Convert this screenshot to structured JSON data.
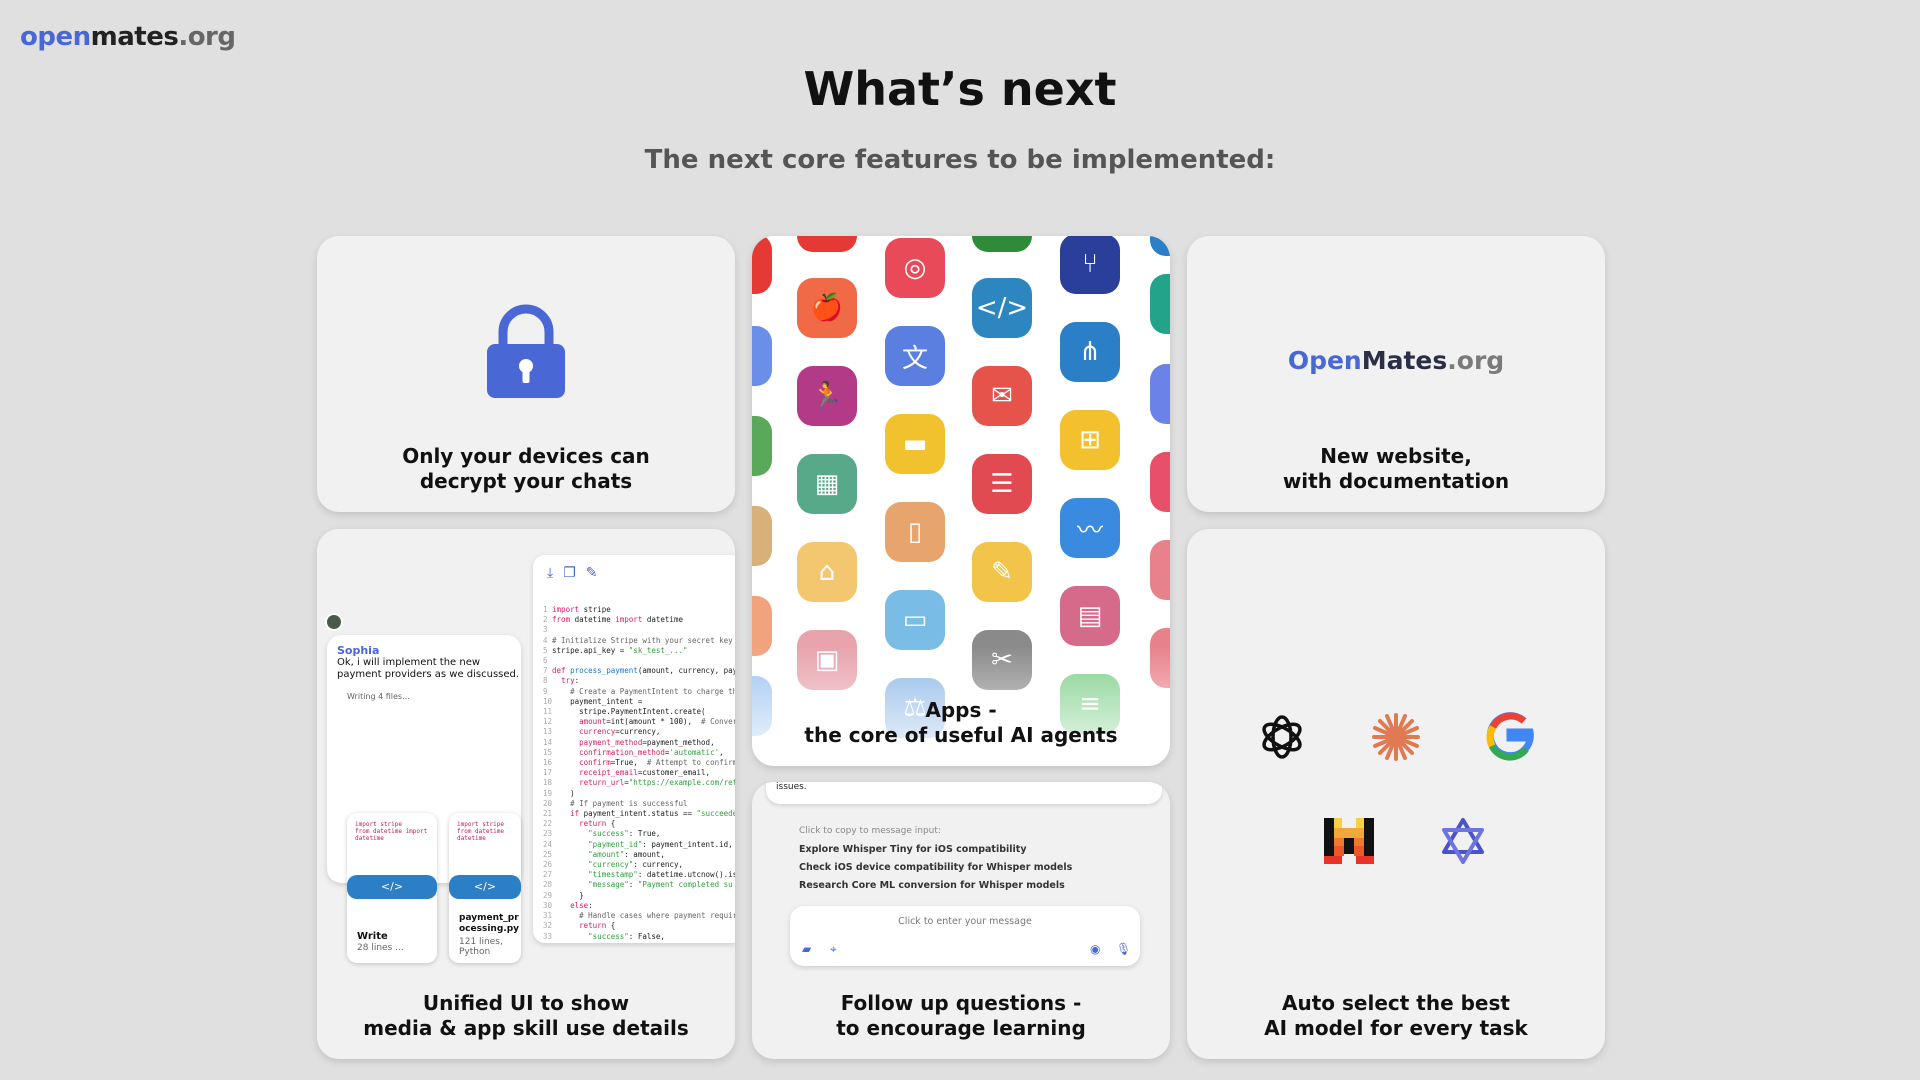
{
  "brand": {
    "open": "open",
    "mates": "mates",
    "org": ".org"
  },
  "title": "What’s next",
  "subtitle": "The next core features to be implemented:",
  "cards": {
    "encryption": {
      "line1": "Only your devices can",
      "line2": "decrypt your chats",
      "icon": "lock-icon"
    },
    "apps": {
      "line1": "Apps -",
      "line2": "the core of useful AI agents"
    },
    "website": {
      "logo_open": "Open",
      "logo_mates": "Mates",
      "logo_org": ".org",
      "line1": "New website,",
      "line2": "with documentation"
    },
    "unified_ui": {
      "line1": "Unified UI to show",
      "line2": "media & app skill use details"
    },
    "follow_up": {
      "line1": "Follow up questions -",
      "line2": "to encourage learning"
    },
    "ai_models": {
      "line1": "Auto select the best",
      "line2": "AI model for every task"
    }
  },
  "unified_mock": {
    "sender": "Sophia",
    "message": "Ok, i will implement the new payment providers as we discussed.",
    "writing": "Writing 4 files...",
    "file1": {
      "title": "Write",
      "sub": "28 lines ..."
    },
    "file2": {
      "title": "payment_processing.py",
      "sub": "121 lines, Python"
    }
  },
  "follow_mock": {
    "issues": "issues.",
    "copy_hint": "Click to copy to message input:",
    "suggestions": [
      "Explore Whisper Tiny for iOS compatibility",
      "Check iOS device compatibility for Whisper models",
      "Research Core ML conversion for Whisper models"
    ],
    "placeholder": "Click to enter your message"
  },
  "ai_icons": [
    "openai-icon",
    "anthropic-icon",
    "google-icon",
    "mistral-icon",
    "deepseek-icon"
  ],
  "colors": {
    "accent": "#4a67d6",
    "background": "#e0e0e0",
    "card": "#f1f1f1"
  }
}
